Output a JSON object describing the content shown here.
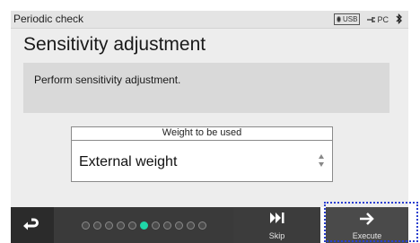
{
  "statusbar": {
    "title": "Periodic check",
    "usb_label": "USB",
    "pc_label": "PC",
    "icons": [
      "usb-icon",
      "pc-connection-icon",
      "bluetooth-icon"
    ]
  },
  "page": {
    "title": "Sensitivity adjustment",
    "message": "Perform sensitivity adjustment."
  },
  "weight": {
    "label": "Weight to be used",
    "selected": "External weight"
  },
  "progress": {
    "total_steps": 11,
    "current_step": 6,
    "active_color": "#1fd6a8"
  },
  "bottombar": {
    "back_icon": "return-arrow-icon",
    "skip_label": "Skip",
    "skip_icon": "skip-forward-icon",
    "execute_label": "Execute",
    "execute_icon": "arrow-right-icon"
  }
}
